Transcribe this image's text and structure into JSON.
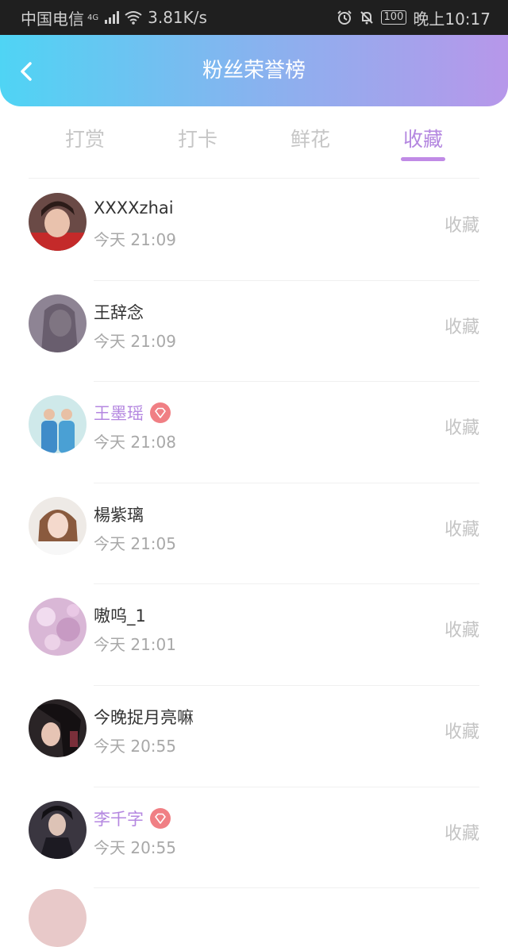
{
  "status_bar": {
    "carrier": "中国电信",
    "network": "4G",
    "speed": "3.81K/s",
    "battery": "100",
    "time": "晚上10:17"
  },
  "header": {
    "title": "粉丝荣誉榜"
  },
  "tabs": [
    {
      "label": "打赏"
    },
    {
      "label": "打卡"
    },
    {
      "label": "鲜花"
    },
    {
      "label": "收藏"
    }
  ],
  "active_tab": "收藏",
  "fans": [
    {
      "name": "XXXXzhai",
      "time": "今天 21:09",
      "action": "收藏",
      "vip": false
    },
    {
      "name": "王辞念",
      "time": "今天 21:09",
      "action": "收藏",
      "vip": false
    },
    {
      "name": "王墨瑶",
      "time": "今天 21:08",
      "action": "收藏",
      "vip": true
    },
    {
      "name": "楊紫璃",
      "time": "今天 21:05",
      "action": "收藏",
      "vip": false
    },
    {
      "name": "嗷呜_1",
      "time": "今天 21:01",
      "action": "收藏",
      "vip": false
    },
    {
      "name": "今晚捉月亮嘛",
      "time": "今天 20:55",
      "action": "收藏",
      "vip": false
    },
    {
      "name": "李千字",
      "time": "今天 20:55",
      "action": "收藏",
      "vip": true
    }
  ],
  "colors": {
    "header_start": "#4fd4f4",
    "header_end": "#b797ea",
    "active_tab": "#b487e0",
    "vip_name": "#b487e0",
    "vip_badge": "#f07f84"
  }
}
